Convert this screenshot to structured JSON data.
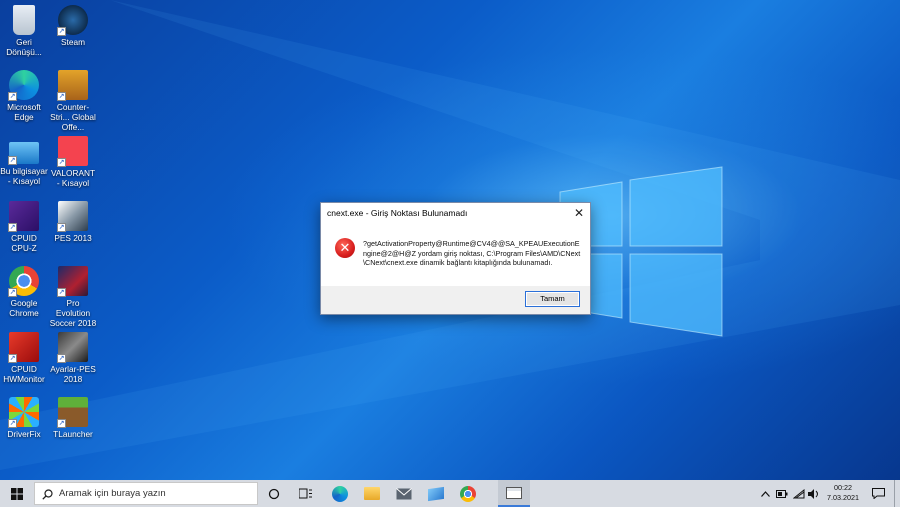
{
  "desktop_icons": [
    {
      "name": "recycle-bin",
      "label": "Geri Dönüşü...",
      "icon": "recycle-bin-icon"
    },
    {
      "name": "steam",
      "label": "Steam",
      "icon": "steam-icon"
    },
    {
      "name": "microsoft-edge",
      "label": "Microsoft Edge",
      "icon": "edge-icon"
    },
    {
      "name": "counter-strike",
      "label": "Counter-Stri... Global Offe...",
      "icon": "csgo-icon"
    },
    {
      "name": "this-pc",
      "label": "Bu bilgisayar - Kısayol",
      "icon": "computer-icon"
    },
    {
      "name": "valorant",
      "label": "VALORANT - Kısayol",
      "icon": "valorant-icon"
    },
    {
      "name": "cpuid-cpuz",
      "label": "CPUID CPU-Z",
      "icon": "cpuz-icon"
    },
    {
      "name": "pes-2013",
      "label": "PES 2013",
      "icon": "pes2013-icon"
    },
    {
      "name": "google-chrome",
      "label": "Google Chrome",
      "icon": "chrome-icon"
    },
    {
      "name": "pes-2018",
      "label": "Pro Evolution Soccer 2018",
      "icon": "pes2018-icon"
    },
    {
      "name": "cpuid-hwmonitor",
      "label": "CPUID HWMonitor",
      "icon": "hwmonitor-icon"
    },
    {
      "name": "ayarlar-pes",
      "label": "Ayarlar-PES 2018",
      "icon": "settings-pes-icon"
    },
    {
      "name": "driverfix",
      "label": "DriverFix",
      "icon": "driverfix-icon"
    },
    {
      "name": "tlauncher",
      "label": "TLauncher",
      "icon": "tlauncher-icon"
    }
  ],
  "dialog": {
    "title": "cnext.exe - Giriş Noktası Bulunamadı",
    "close_glyph": "✕",
    "icon": "error-icon",
    "message": "?getActivationProperty@Runtime@CV4@@SA_KPEAUExecutionEngine@2@H@Z yordam giriş noktası, C:\\Program Files\\AMD\\CNext\\CNext\\cnext.exe dinamik bağlantı kitaplığında bulunamadı.",
    "ok_label": "Tamam"
  },
  "taskbar": {
    "search_placeholder": "Aramak için buraya yazın",
    "apps": [
      "task-view-icon",
      "widgets-icon",
      "edge-icon",
      "file-explorer-icon",
      "mail-icon",
      "photos-icon",
      "chrome-icon",
      "running-app-icon"
    ],
    "tray": {
      "time": "00:22",
      "date": "7.03.2021"
    }
  },
  "colors": {
    "accent": "#0078d7",
    "error": "#d81e1e",
    "taskbar": "#d7dbe2"
  }
}
